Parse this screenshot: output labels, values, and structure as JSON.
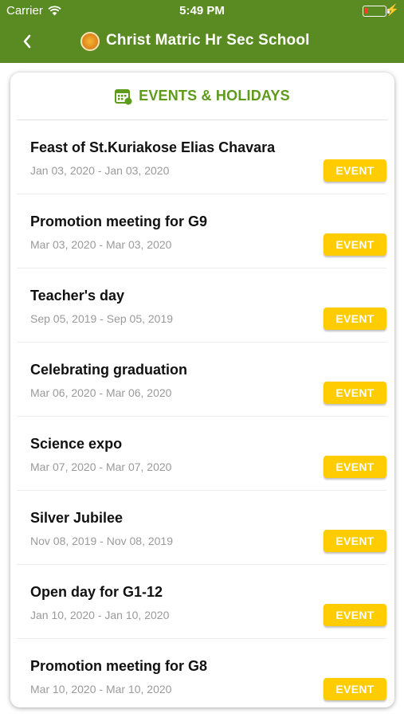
{
  "status_bar": {
    "carrier": "Carrier",
    "time": "5:49 PM",
    "battery_color": "#ff3b30"
  },
  "nav": {
    "title": "Christ Matric Hr Sec School",
    "back_icon": "chevron-left-icon",
    "logo_icon": "school-logo",
    "color": "#5a8a22"
  },
  "section": {
    "title": "EVENTS & HOLIDAYS",
    "icon": "calendar-icon",
    "accent": "#5e9a1c"
  },
  "events": [
    {
      "title": "Feast of St.Kuriakose Elias Chavara",
      "dates": "Jan 03, 2020 - Jan 03, 2020",
      "tag": "EVENT"
    },
    {
      "title": "Promotion meeting for G9",
      "dates": "Mar 03, 2020 - Mar 03, 2020",
      "tag": "EVENT"
    },
    {
      "title": "Teacher's day",
      "dates": "Sep 05, 2019 - Sep 05, 2019",
      "tag": "EVENT"
    },
    {
      "title": "Celebrating graduation",
      "dates": "Mar 06, 2020 - Mar 06, 2020",
      "tag": "EVENT"
    },
    {
      "title": "Science expo",
      "dates": "Mar 07, 2020 - Mar 07, 2020",
      "tag": "EVENT"
    },
    {
      "title": "Silver Jubilee",
      "dates": "Nov 08, 2019 - Nov 08, 2019",
      "tag": "EVENT"
    },
    {
      "title": "Open day for G1-12",
      "dates": "Jan 10, 2020 - Jan 10, 2020",
      "tag": "EVENT"
    },
    {
      "title": "Promotion meeting for G8",
      "dates": "Mar 10, 2020 - Mar 10, 2020",
      "tag": "EVENT"
    }
  ],
  "badge_color": "#ffcc00"
}
